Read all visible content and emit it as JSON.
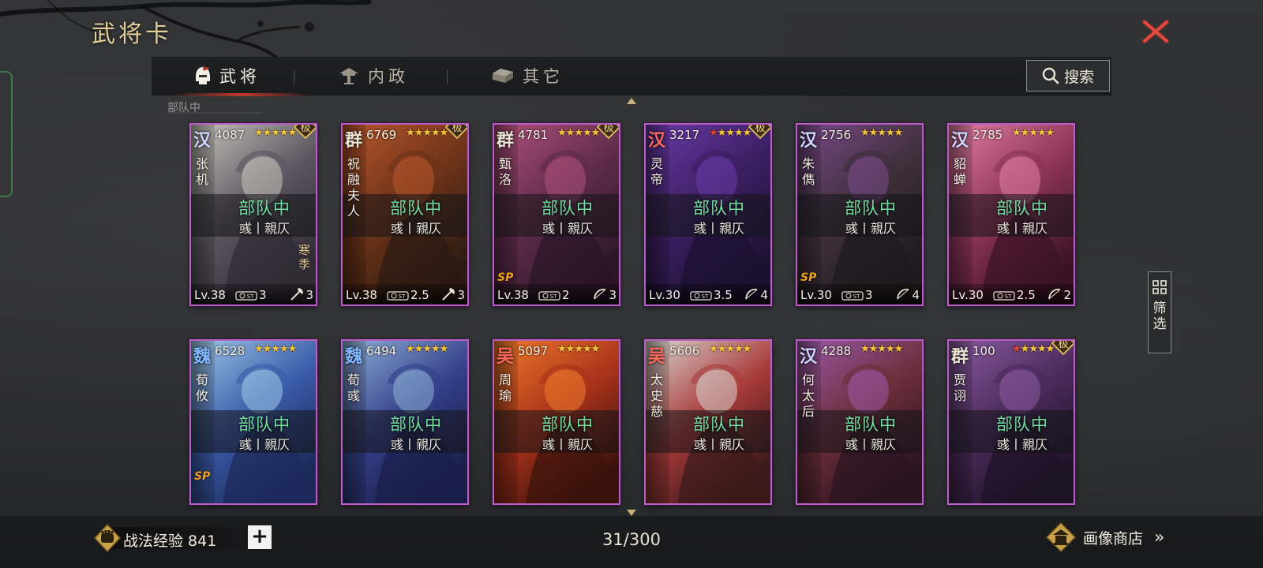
{
  "header": {
    "title": "武将卡"
  },
  "tabs": [
    {
      "label": "武将",
      "icon": "helmet-icon",
      "active": true
    },
    {
      "label": "内政",
      "icon": "tower-icon",
      "active": false
    },
    {
      "label": "其它",
      "icon": "chest-icon",
      "active": false
    }
  ],
  "search": {
    "label": "搜索"
  },
  "filter": {
    "label": "筛选"
  },
  "partial_row_label": "部队中",
  "cards": [
    {
      "faction": "汉",
      "faction_color": "#cfd6ff",
      "cost": "4087",
      "stars_red": 0,
      "name": "张机",
      "status": "部队中",
      "sub": "彧丨親仄",
      "lv": "Lv.38",
      "cost_val": "3",
      "range": "3",
      "range_icon": "axe-icon",
      "ji": true,
      "season": "寒季",
      "sp": false,
      "palette": [
        "#c8c6bd",
        "#5a5560",
        "#2f2b35"
      ]
    },
    {
      "faction": "群",
      "faction_color": "#e8e2d2",
      "cost": "6769",
      "stars_red": 0,
      "name": "祝融夫人",
      "status": "部队中",
      "sub": "彧丨親仄",
      "lv": "Lv.38",
      "cost_val": "2.5",
      "range": "3",
      "range_icon": "axe-icon",
      "ji": true,
      "season": "",
      "sp": false,
      "palette": [
        "#b8562c",
        "#6b3218",
        "#2b1a12"
      ]
    },
    {
      "faction": "群",
      "faction_color": "#e8e2d2",
      "cost": "4781",
      "stars_red": 0,
      "name": "甄洛",
      "status": "部队中",
      "sub": "彧丨親仄",
      "lv": "Lv.38",
      "cost_val": "2",
      "range": "3",
      "range_icon": "bow-icon",
      "ji": true,
      "season": "",
      "sp": true,
      "palette": [
        "#b0507a",
        "#5d2b4a",
        "#2a1626"
      ]
    },
    {
      "faction": "汉",
      "faction_color": "#ff6a5e",
      "cost": "3217",
      "stars_red": 1,
      "name": "灵帝",
      "status": "部队中",
      "sub": "彧丨親仄",
      "lv": "Lv.30",
      "cost_val": "3.5",
      "range": "4",
      "range_icon": "bow-icon",
      "ji": true,
      "season": "",
      "sp": false,
      "palette": [
        "#6a3aa8",
        "#3a1e60",
        "#1c1030"
      ]
    },
    {
      "faction": "汉",
      "faction_color": "#cfd6ff",
      "cost": "2756",
      "stars_red": 0,
      "name": "朱儁",
      "status": "部队中",
      "sub": "彧丨親仄",
      "lv": "Lv.30",
      "cost_val": "3",
      "range": "4",
      "range_icon": "bow-icon",
      "ji": false,
      "season": "",
      "sp": true,
      "palette": [
        "#7a4a8a",
        "#3e2f3a",
        "#1e1a1d"
      ]
    },
    {
      "faction": "汉",
      "faction_color": "#cfd6ff",
      "cost": "2785",
      "stars_red": 0,
      "name": "貂蝉",
      "status": "部队中",
      "sub": "彧丨親仄",
      "lv": "Lv.30",
      "cost_val": "2.5",
      "range": "2",
      "range_icon": "bow-icon",
      "ji": false,
      "season": "",
      "sp": false,
      "palette": [
        "#e27ea2",
        "#8a3256",
        "#3a1226"
      ]
    },
    {
      "faction": "魏",
      "faction_color": "#7fb6ff",
      "cost": "6528",
      "stars_red": 0,
      "name": "荀攸",
      "status": "部队中",
      "sub": "彧丨親仄",
      "lv": "",
      "cost_val": "",
      "range": "",
      "range_icon": "axe-icon",
      "ji": false,
      "season": "",
      "sp": true,
      "palette": [
        "#9fc8e8",
        "#3a5aa8",
        "#1c2a5a"
      ]
    },
    {
      "faction": "魏",
      "faction_color": "#7fb6ff",
      "cost": "6494",
      "stars_red": 0,
      "name": "荀彧",
      "status": "部队中",
      "sub": "彧丨親仄",
      "lv": "",
      "cost_val": "",
      "range": "",
      "range_icon": "axe-icon",
      "ji": false,
      "season": "",
      "sp": false,
      "palette": [
        "#8fb0d8",
        "#34408a",
        "#1a1e48"
      ]
    },
    {
      "faction": "吴",
      "faction_color": "#ff6a5e",
      "cost": "5097",
      "stars_red": 0,
      "name": "周瑜",
      "status": "部队中",
      "sub": "彧丨親仄",
      "lv": "",
      "cost_val": "",
      "range": "",
      "range_icon": "bow-icon",
      "ji": false,
      "season": "",
      "sp": false,
      "palette": [
        "#f07a2a",
        "#a8321a",
        "#3a120c"
      ]
    },
    {
      "faction": "吴",
      "faction_color": "#ff6a5e",
      "cost": "5606",
      "stars_red": 0,
      "name": "太史慈",
      "status": "部队中",
      "sub": "彧丨親仄",
      "lv": "",
      "cost_val": "",
      "range": "",
      "range_icon": "bow-icon",
      "ji": false,
      "season": "",
      "sp": false,
      "palette": [
        "#d9d6d0",
        "#a83a3a",
        "#3a1a1a"
      ]
    },
    {
      "faction": "汉",
      "faction_color": "#cfd6ff",
      "cost": "4288",
      "stars_red": 0,
      "name": "何太后",
      "status": "部队中",
      "sub": "彧丨親仄",
      "lv": "",
      "cost_val": "",
      "range": "",
      "range_icon": "bow-icon",
      "ji": false,
      "season": "",
      "sp": false,
      "palette": [
        "#9a5aa8",
        "#6a2e3a",
        "#2a1420"
      ]
    },
    {
      "faction": "群",
      "faction_color": "#e8e2d2",
      "cost": "100",
      "stars_red": 1,
      "name": "贾诩",
      "status": "部队中",
      "sub": "彧丨親仄",
      "lv": "",
      "cost_val": "",
      "range": "",
      "range_icon": "axe-icon",
      "ji": true,
      "season": "",
      "sp": false,
      "palette": [
        "#8a5aa0",
        "#4a2a5a",
        "#1e1226"
      ]
    }
  ],
  "footer": {
    "exp_label": "战法经验 841",
    "plus_label": "+",
    "count": "31/300",
    "shop_label": "画像商店",
    "shop_arrow": "»"
  },
  "colors": {
    "accent_red": "#c0392b",
    "status_green": "#74dca0",
    "card_border": "#b85fc4",
    "star_gold": "#f6c53b",
    "star_red": "#e8452f"
  }
}
